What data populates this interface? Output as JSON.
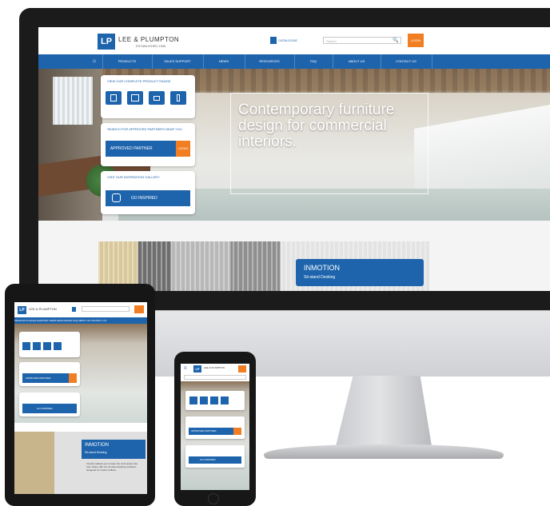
{
  "brand": {
    "logo_mark": "LP",
    "name": "LEE & PLUMPTON",
    "subtitle": "ESTABLISHED 1906"
  },
  "header": {
    "catalogue_label": "CATALOGUE",
    "search_placeholder": "Search",
    "login_label": "LOGIN"
  },
  "nav": {
    "home_icon": "home-icon",
    "items": [
      "PRODUCTS",
      "SALES SUPPORT",
      "NEWS",
      "RESOURCES",
      "FAQ",
      "ABOUT US",
      "CONTACT US"
    ]
  },
  "hero": {
    "tagline": "Contemporary furniture design for commercial interiors."
  },
  "cards": {
    "range": {
      "title": "VIEW OUR COMPLETE PRODUCT RANGE",
      "icons": [
        "desk-icon",
        "screen-icon",
        "sofa-icon",
        "lamp-icon"
      ]
    },
    "partner": {
      "title": "SEARCH FOR APPROVED PARTNERS NEAR YOU",
      "button_label": "APPROVED PARTNER",
      "tab_label": "LOGIN"
    },
    "inspired": {
      "title": "VISIT OUR INSPIRATION GALLERY",
      "button_label": "GO INSPIRED",
      "icon": "instagram-icon"
    }
  },
  "feature": {
    "title": "INMOTION",
    "subtitle": "Sit-stand Desking"
  },
  "tablet": {
    "nav_text": "PRODUCTS  SALES SUPPORT  NEWS  RESOURCES  FAQ  ABOUT US  CONTACT US",
    "feature_text": "Inmotion allows you to keep the work space free from clutter with our sit-stand desking solutions designed for modern offices."
  },
  "colors": {
    "brand_blue": "#1e64ad",
    "accent_orange": "#f17e22"
  }
}
